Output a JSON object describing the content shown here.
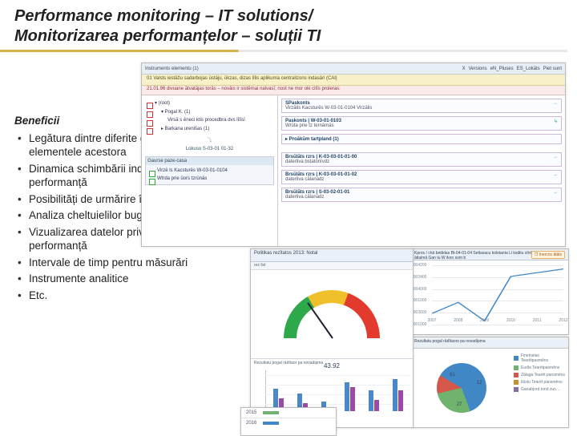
{
  "title_en": "Performance monitoring – IT solutions/",
  "title_ro": "Monitorizarea performanțelor – soluții TI",
  "benefits": {
    "heading": "Beneficii",
    "items": [
      "Legătura dintre diferite documente și elementele acestora",
      "Dinamica schimbării indicatorilor de performanță",
      "Posibilități de urmărire în timp real",
      "Analiza  cheltuielilor bugetare",
      "Vizualizarea datelor privind indicatorii de performanță",
      "Intervale de timp pentru măsurări",
      "Instrumente analitice",
      "Etc."
    ]
  },
  "top_panel": {
    "toolbar": [
      "Instruments  elementu (1)",
      "X",
      "Versions",
      "eN_Pluses",
      "ES_Lokāts",
      "Piet sunt"
    ],
    "row_yellow": "01  Valsts iestāžu sadarbojas ūstāju, ūkzas, dizas līlis aplikuma centralizons indasāri (CAl)",
    "row_red": "21.01.96  divuane ātvatājas torās – novāis ir sistēmai nalvasī; nost ne mor oki citīs proleras:",
    "left_tree": [
      {
        "label": "▾ (root)",
        "cls": "red"
      },
      {
        "label": "▾ Pogal K. (1)",
        "cls": "red"
      },
      {
        "label": "Virsā s ēneci ktis procedbra dvs līlīsī",
        "cls": "red"
      },
      {
        "label": "▸ Barkana urenišas (1)",
        "cls": "red"
      }
    ],
    "left_subhdr": "Lokuso  S-03-01  01-32",
    "left_sub": {
      "title": "Gaurse  paze-casa",
      "items": [
        "Virzē ls Kacsturēs  W-03-01-0104",
        "Wtrda prie ūors tzrūnās"
      ]
    },
    "right_cards": [
      {
        "h": "SPaskonts",
        "sub": "Virzālis Kacsturēs  W-03-01-0104  Virzālis",
        "arrow": "→"
      },
      {
        "h": "Paskonts  | W-03-01-0103",
        "sub": "Wrūta prie tz ternāmās",
        "arrow": "↳"
      },
      {
        "h": "▸ Proākūm tartpland (1)",
        "sub": "",
        "arrow": ""
      }
    ],
    "right_cards2": [
      {
        "h": "Brsūlāts rzrs",
        "sub": "K-03-03-01-01-00",
        "sub2": "daterliva bstatonīvdz"
      },
      {
        "h": "Brsūlāts rzrs",
        "sub": "K-03-03-01-01-02",
        "sub2": "daterliva cālanadz"
      },
      {
        "h": "Brsūlāts rzrs",
        "sub": "S-03-02-01-01",
        "sub2": "daterliva cālanadz"
      }
    ]
  },
  "gauge_panel": {
    "title": "Politikas rezītatos 2013: Notal",
    "subtitle": "rez list",
    "value": "43.92",
    "max": "100",
    "bars_title": "Rezultatu pogal rādītaor pa novadipma",
    "bar_pairs": [
      {
        "a": 28,
        "b": 16
      },
      {
        "a": 22,
        "b": 10
      },
      {
        "a": 12,
        "b": 4
      },
      {
        "a": 36,
        "b": 30
      },
      {
        "a": 26,
        "b": 14
      },
      {
        "a": 40,
        "b": 26
      }
    ]
  },
  "line_panel": {
    "title": "Kpros / chā bettidas  Bt-04-01-04 Setlasacu kolstanta Ll ksditu sīntitz mun demo",
    "title2": "ātlaimā Gan tu W ikno som b",
    "btn": "❐ Inercns ātāls",
    "y_ticks": [
      1004200,
      1002400,
      1004000,
      1001000,
      1002600,
      1001000
    ],
    "x_ticks": [
      2007,
      2008,
      2009,
      2010,
      2011,
      2012
    ]
  },
  "chart_data": {
    "type": "line",
    "x": [
      2007,
      2008,
      2009,
      2010,
      2011,
      2012
    ],
    "values": [
      1001600,
      1002200,
      1001200,
      1003600,
      1003800,
      1004000
    ],
    "ylim": [
      1001000,
      1004200
    ],
    "title": "Kpros / chā bettidas",
    "xlabel": "",
    "ylabel": ""
  },
  "pie_panel": {
    "title": "Rezultatu pogal rādītaors pa novadipma",
    "slices": [
      {
        "label": "61",
        "color": "#3f88c5",
        "pct": 61
      },
      {
        "label": "27",
        "color": "#6fb36f",
        "pct": 27
      },
      {
        "label": "12",
        "color": "#d6584a",
        "pct": 12
      }
    ],
    "legend": [
      "Finetnelas Tearētpasmēns",
      "Eudla Tearētpasmēns",
      "Zālaga Tearēt pansmēns",
      "Ilūstu Tearēt pansmēns",
      "Ganabjord tond zun…"
    ]
  },
  "year_panel": {
    "rows": [
      {
        "year": "2015",
        "color": "#6fb36f"
      },
      {
        "year": "2016",
        "color": "#3f88c5"
      }
    ]
  }
}
